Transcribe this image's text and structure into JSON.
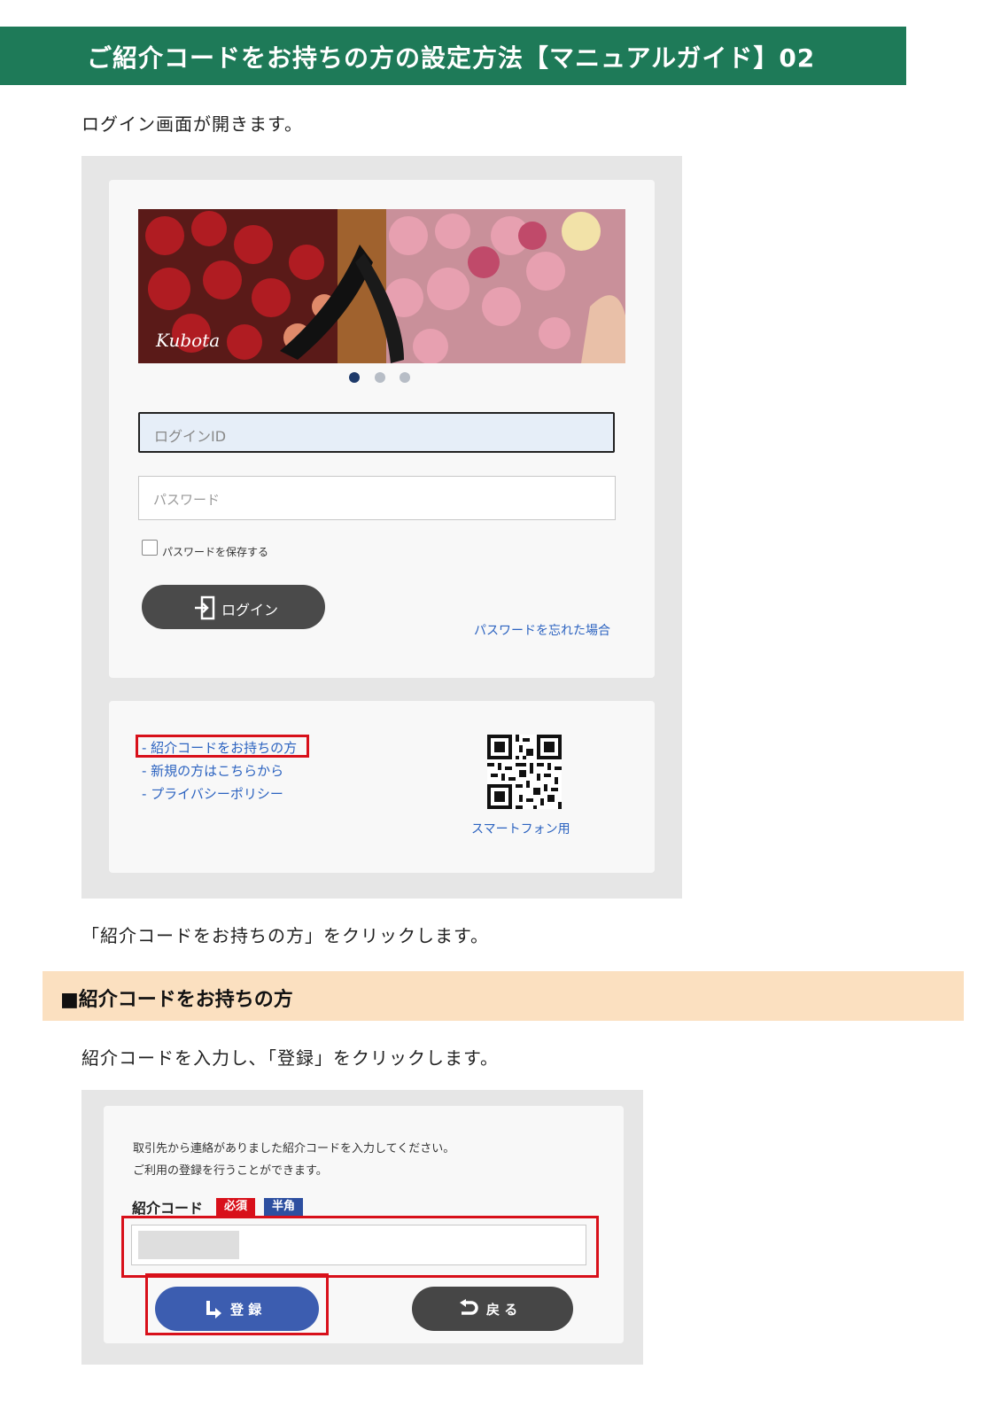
{
  "header": {
    "title": "ご紹介コードをお持ちの方の設定方法【マニュアルガイド】02"
  },
  "step1": {
    "caption": "ログイン画面が開きます。"
  },
  "login_screen": {
    "carousel": {
      "slide_count": 3,
      "active_index": 0
    },
    "login_id": {
      "placeholder": "ログインID"
    },
    "password": {
      "placeholder": "パスワード"
    },
    "save_password_label": "パスワードを保存する",
    "login_button": "ログイン",
    "forgot_password": "パスワードを忘れた場合",
    "links": [
      "- 紹介コードをお持ちの方",
      "- 新規の方はこちらから",
      "- プライバシーポリシー"
    ],
    "smartphone_label": "スマートフォン用"
  },
  "step2": {
    "caption": "「紹介コードをお持ちの方」をクリックします。"
  },
  "section": {
    "heading": "■紹介コードをお持ちの方"
  },
  "step3": {
    "caption": "紹介コードを入力し､「登録」をクリックします。"
  },
  "code_form": {
    "instruction_1": "取引先から連絡がありました紹介コードを入力してください。",
    "instruction_2": "ご利用の登録を行うことができます。",
    "field_label": "紹介コード",
    "badge_required": "必須",
    "badge_halfwidth": "半角",
    "register_button": "登 録",
    "back_button": "戻 る"
  },
  "colors": {
    "title_bar": "#1e7a58",
    "section_bar": "#fbe0c0",
    "highlight": "#d8101a",
    "link": "#2c63c0",
    "register": "#3c5db0"
  }
}
